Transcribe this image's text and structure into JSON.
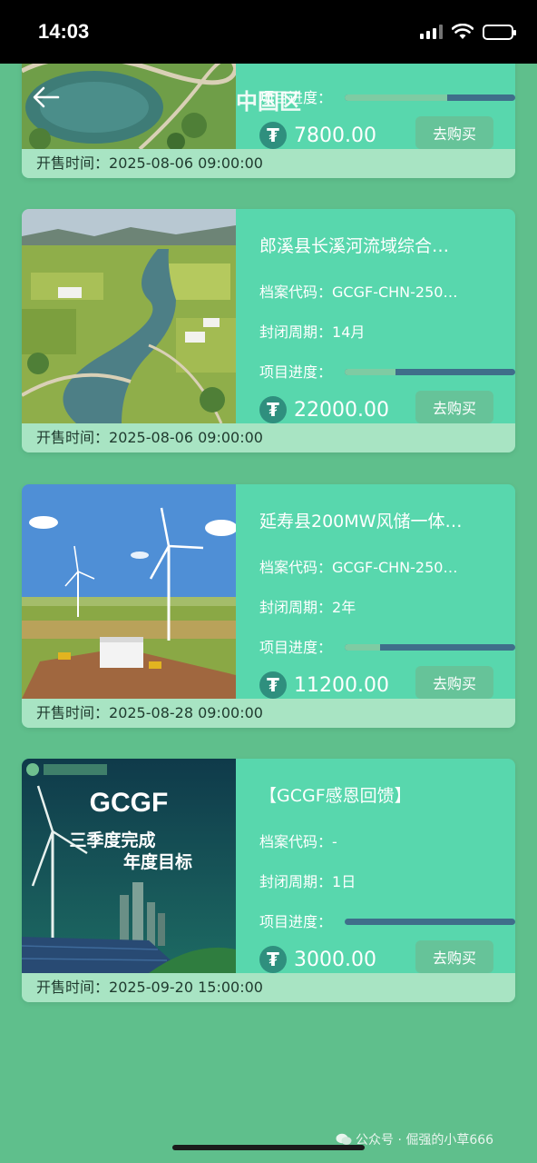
{
  "status_bar": {
    "time": "14:03"
  },
  "header": {
    "title": "中国区"
  },
  "labels": {
    "code": "档案代码：",
    "period": "封闭周期：",
    "progress": "项目进度：",
    "sale_time": "开售时间："
  },
  "coin_symbol": "₮",
  "cards": [
    {
      "title": "",
      "code": "",
      "period": "",
      "progress": 0.6,
      "price": "7800.00",
      "buy_label": "去购买",
      "sale_time": "2025-08-06 09:00:00"
    },
    {
      "title": "郎溪县长溪河流域综合…",
      "code": "GCGF-CHN-250…",
      "period": "14月",
      "progress": 0.3,
      "price": "22000.00",
      "buy_label": "去购买",
      "sale_time": "2025-08-06 09:00:00"
    },
    {
      "title": "延寿县200MW风储一体…",
      "code": "GCGF-CHN-250…",
      "period": "2年",
      "progress": 0.21,
      "price": "11200.00",
      "buy_label": "去购买",
      "sale_time": "2025-08-28 09:00:00"
    },
    {
      "title": "【GCGF感恩回馈】",
      "code": "-",
      "period": "1日",
      "progress": 0.0,
      "price": "3000.00",
      "buy_label": "去购买",
      "sale_time": "2025-09-20 15:00:00",
      "poster": {
        "brand": "GCGF",
        "line1": "三季度完成",
        "line2": "年度目标"
      }
    }
  ],
  "watermark": "公众号 · 倔强的小草666",
  "colors": {
    "background": "#5fbf8c",
    "card": "#58d7ad",
    "progress_track": "#3f6e8a",
    "progress_fill": "#7fcba3"
  }
}
